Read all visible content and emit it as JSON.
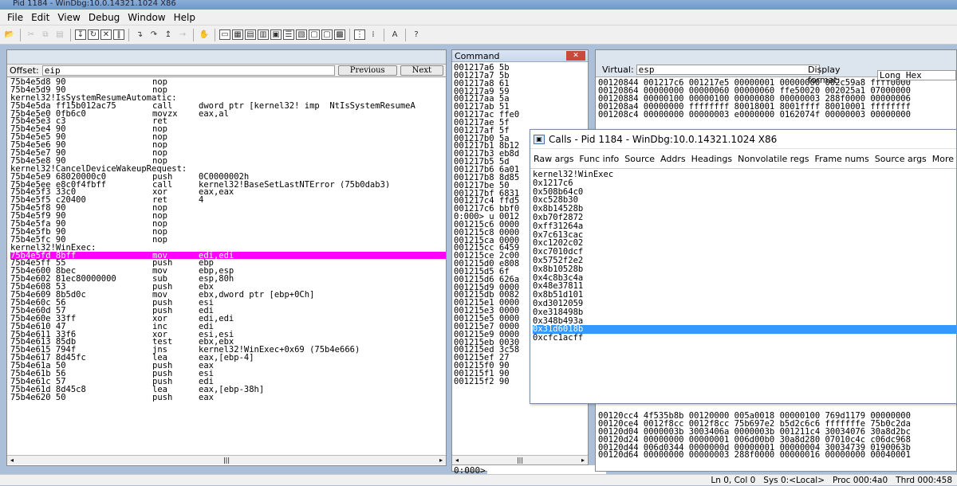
{
  "window": {
    "title": "Pid 1184 - WinDbg:10.0.14321.1024 X86"
  },
  "menu": [
    "File",
    "Edit",
    "View",
    "Debug",
    "Window",
    "Help"
  ],
  "disasm": {
    "offset_label": "Offset:",
    "offset_value": "eip",
    "previous_label": "Previous",
    "next_label": "Next",
    "lines": [
      {
        "a": "75b4e5d8 90",
        "m": "nop",
        "o": ""
      },
      {
        "a": "75b4e5d9 90",
        "m": "nop",
        "o": ""
      },
      {
        "a": "kernel32!IsSystemResumeAutomatic:",
        "m": "",
        "o": ""
      },
      {
        "a": "75b4e5da ff15b012ac75",
        "m": "call",
        "o": "dword ptr [kernel32!_imp__NtIsSystemResumeA"
      },
      {
        "a": "75b4e5e0 0fb6c0",
        "m": "movzx",
        "o": "eax,al"
      },
      {
        "a": "75b4e5e3 c3",
        "m": "ret",
        "o": ""
      },
      {
        "a": "75b4e5e4 90",
        "m": "nop",
        "o": ""
      },
      {
        "a": "75b4e5e5 90",
        "m": "nop",
        "o": ""
      },
      {
        "a": "75b4e5e6 90",
        "m": "nop",
        "o": ""
      },
      {
        "a": "75b4e5e7 90",
        "m": "nop",
        "o": ""
      },
      {
        "a": "75b4e5e8 90",
        "m": "nop",
        "o": ""
      },
      {
        "a": "kernel32!CancelDeviceWakeupRequest:",
        "m": "",
        "o": ""
      },
      {
        "a": "75b4e5e9 68020000c0",
        "m": "push",
        "o": "0C0000002h"
      },
      {
        "a": "75b4e5ee e8c0f4fbff",
        "m": "call",
        "o": "kernel32!BaseSetLastNTError (75b0dab3)"
      },
      {
        "a": "75b4e5f3 33c0",
        "m": "xor",
        "o": "eax,eax"
      },
      {
        "a": "75b4e5f5 c20400",
        "m": "ret",
        "o": "4"
      },
      {
        "a": "75b4e5f8 90",
        "m": "nop",
        "o": ""
      },
      {
        "a": "75b4e5f9 90",
        "m": "nop",
        "o": ""
      },
      {
        "a": "75b4e5fa 90",
        "m": "nop",
        "o": ""
      },
      {
        "a": "75b4e5fb 90",
        "m": "nop",
        "o": ""
      },
      {
        "a": "75b4e5fc 90",
        "m": "nop",
        "o": ""
      },
      {
        "a": "kernel32!WinExec:",
        "m": "",
        "o": ""
      },
      {
        "a": "75b4e5fd 8bff",
        "m": "mov",
        "o": "edi,edi",
        "hl": true
      },
      {
        "a": "75b4e5ff 55",
        "m": "push",
        "o": "ebp"
      },
      {
        "a": "75b4e600 8bec",
        "m": "mov",
        "o": "ebp,esp"
      },
      {
        "a": "75b4e602 81ec80000000",
        "m": "sub",
        "o": "esp,80h"
      },
      {
        "a": "75b4e608 53",
        "m": "push",
        "o": "ebx"
      },
      {
        "a": "75b4e609 8b5d0c",
        "m": "mov",
        "o": "ebx,dword ptr [ebp+0Ch]"
      },
      {
        "a": "75b4e60c 56",
        "m": "push",
        "o": "esi"
      },
      {
        "a": "75b4e60d 57",
        "m": "push",
        "o": "edi"
      },
      {
        "a": "75b4e60e 33ff",
        "m": "xor",
        "o": "edi,edi"
      },
      {
        "a": "75b4e610 47",
        "m": "inc",
        "o": "edi"
      },
      {
        "a": "75b4e611 33f6",
        "m": "xor",
        "o": "esi,esi"
      },
      {
        "a": "75b4e613 85db",
        "m": "test",
        "o": "ebx,ebx"
      },
      {
        "a": "75b4e615 794f",
        "m": "jns",
        "o": "kernel32!WinExec+0x69 (75b4e666)"
      },
      {
        "a": "75b4e617 8d45fc",
        "m": "lea",
        "o": "eax,[ebp-4]"
      },
      {
        "a": "75b4e61a 50",
        "m": "push",
        "o": "eax"
      },
      {
        "a": "75b4e61b 56",
        "m": "push",
        "o": "esi"
      },
      {
        "a": "75b4e61c 57",
        "m": "push",
        "o": "edi"
      },
      {
        "a": "75b4e61d 8d45c8",
        "m": "lea",
        "o": "eax,[ebp-38h]"
      },
      {
        "a": "75b4e620 50",
        "m": "push",
        "o": "eax"
      }
    ]
  },
  "command": {
    "title": "Command",
    "prompt": "0:000>",
    "lines": [
      "001217a6 5b",
      "001217a7 5b",
      "001217a8 61",
      "001217a9 59",
      "001217aa 5a",
      "001217ab 51",
      "001217ac ffe0",
      "001217ae 5f",
      "001217af 5f",
      "001217b0 5a",
      "001217b1 8b12",
      "001217b3 eb8d",
      "001217b5 5d",
      "001217b6 6a01",
      "001217b8 8d85",
      "001217be 50",
      "001217bf 6831",
      "001217c4 ffd5",
      "001217c6 bbf0",
      "0:000> u 0012",
      "001215c6 0000",
      "001215c8 0000",
      "001215ca 0000",
      "001215cc 6459",
      "001215ce 2c00",
      "001215d0 e808",
      "001215d5 6f",
      "001215d6 626a",
      "001215d9 0000",
      "001215db 0082",
      "001215e1 0000",
      "001215e3 0000",
      "001215e5 0000",
      "001215e7 0000",
      "001215e9 0000",
      "001215eb 0030",
      "001215ed 3c58",
      "001215ef 27",
      "001215f0 90",
      "001215f1 90",
      "001215f2 90"
    ]
  },
  "memory": {
    "virtual_label": "Virtual:",
    "virtual_value": "esp",
    "display_format_label": "Display format:",
    "display_format_value": "Long Hex",
    "top_lines": [
      "00120844 001217c6 001217e5 00000001 00000000 002c59a8 ffff0000",
      "00120864 00000000 00000060 00000060 ffe50020 002025a1 07000000",
      "00120884 00000100 00000100 00000080 00000003 288f0000 00000006",
      "001208a4 00000000 ffffffff 80018001 8001ffff 80010001 ffffffff",
      "001208c4 00000000 00000003 e0000000 0162074f 00000003 00000000"
    ],
    "bottom_lines": [
      "00120cc4 4f535b8b 00120000 005a0018 00000100 769d1179 00000000",
      "00120ce4 0012f8cc 0012f8cc 75b697e2 b5d2c6c6 fffffffe 75b0c2da",
      "00120d04 0000003b 3003406a 0000003b 001211c4 30034076 30a8d2bc",
      "00120d24 00000000 00000001 006d00b0 30a8d280 07010c4c c06dc968",
      "00120d44 006d0344 0000000d 00000001 00000004 30034739 0190063b",
      "00120d64 00000000 00000003 288f0000 00000016 00000000 00040001"
    ]
  },
  "calls": {
    "title": "Calls - Pid 1184 - WinDbg:10.0.14321.1024 X86",
    "options": [
      "Raw args",
      "Func info",
      "Source",
      "Addrs",
      "Headings",
      "Nonvolatile regs",
      "Frame nums",
      "Source args",
      "More"
    ],
    "frames": [
      "kernel32!WinExec",
      "0x1217c6",
      "0x508b64c0",
      "0xc528b30",
      "0x8b14528b",
      "0xb70f2872",
      "0xff31264a",
      "0x7c613cac",
      "0xc1202c02",
      "0xc7010dcf",
      "0x5752f2e2",
      "0x8b10528b",
      "0x4c8b3c4a",
      "0x48e37811",
      "0x8b51d101",
      "0xd3012059",
      "0xe318498b",
      "0x348b493a",
      "0x31d6018b",
      "0xcfc1acff"
    ],
    "selected_index": 18
  },
  "status": {
    "ln_col": "Ln 0, Col 0",
    "sys": "Sys 0:<Local>",
    "proc": "Proc 000:4a0",
    "thrd": "Thrd 000:458"
  },
  "colors": {
    "highlight_line": "#ff00ff",
    "selected_frame": "#3399ff"
  }
}
